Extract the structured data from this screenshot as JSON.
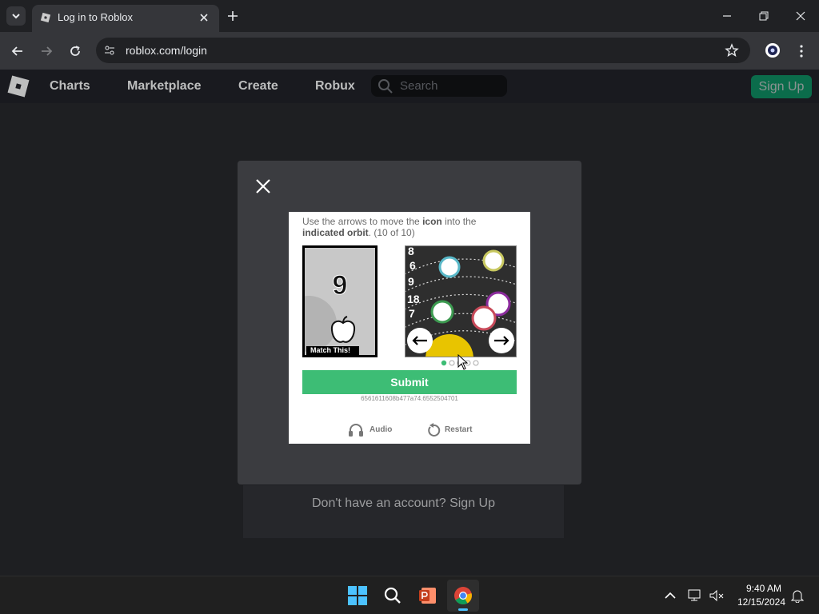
{
  "browser": {
    "tab_title": "Log in to Roblox",
    "url": "roblox.com/login"
  },
  "header": {
    "nav": [
      "Charts",
      "Marketplace",
      "Create",
      "Robux"
    ],
    "search_placeholder": "Search",
    "signup_label": "Sign Up"
  },
  "captcha": {
    "instruction_pre": "Use the arrows to move the ",
    "instruction_icon": "icon",
    "instruction_mid": " into the ",
    "instruction_orbit": "indicated orbit",
    "instruction_post": ". (10 of 10)",
    "target_number": "9",
    "match_label": "Match This!",
    "orbit_numbers": [
      "8",
      "6",
      "9",
      "18",
      "7"
    ],
    "submit_label": "Submit",
    "session_id": "6561611608b477a74.6552504701",
    "audio_label": "Audio",
    "restart_label": "Restart",
    "page_dots_total": 5,
    "page_dots_active": 0
  },
  "page": {
    "signup_prompt": "Don't have an account? Sign Up"
  },
  "taskbar": {
    "time": "9:40 AM",
    "date": "12/15/2024"
  },
  "colors": {
    "accent_green": "#3dbd75",
    "roblox_green": "#00b06f"
  }
}
